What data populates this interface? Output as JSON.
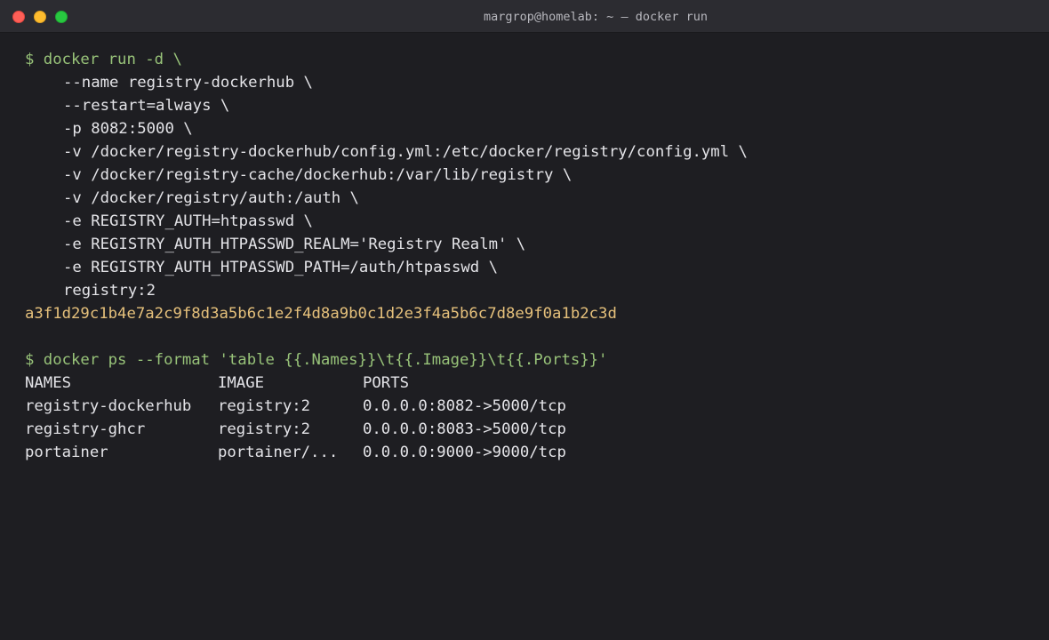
{
  "window": {
    "title": "margrop@homelab: ~ — docker run",
    "buttons": {
      "close": "close",
      "minimize": "minimize",
      "maximize": "maximize"
    }
  },
  "terminal": {
    "run_command": {
      "prompt_line": "$ docker run -d \\",
      "args": [
        "--name registry-dockerhub \\",
        "--restart=always \\",
        "-p 8082:5000 \\",
        "-v /docker/registry-dockerhub/config.yml:/etc/docker/registry/config.yml \\",
        "-v /docker/registry-cache/dockerhub:/var/lib/registry \\",
        "-v /docker/registry/auth:/auth \\",
        "-e REGISTRY_AUTH=htpasswd \\",
        "-e REGISTRY_AUTH_HTPASSWD_REALM='Registry Realm' \\",
        "-e REGISTRY_AUTH_HTPASSWD_PATH=/auth/htpasswd \\",
        "registry:2"
      ],
      "output_hash": "a3f1d29c1b4e7a2c9f8d3a5b6c1e2f4d8a9b0c1d2e3f4a5b6c7d8e9f0a1b2c3d"
    },
    "ps_command": {
      "prompt_line": "$ docker ps --format 'table {{.Names}}\\t{{.Image}}\\t{{.Ports}}'",
      "headers": [
        "NAMES",
        "IMAGE",
        "PORTS"
      ],
      "rows": [
        [
          "registry-dockerhub",
          "registry:2",
          "0.0.0.0:8082->5000/tcp"
        ],
        [
          "registry-ghcr",
          "registry:2",
          "0.0.0.0:8083->5000/tcp"
        ],
        [
          "portainer",
          "portainer/...",
          "0.0.0.0:9000->9000/tcp"
        ]
      ]
    }
  },
  "colors": {
    "background": "#1e1e22",
    "titlebar": "#2c2c31",
    "command": "#98c379",
    "hash": "#e5c07b",
    "text": "#e4e4e8"
  }
}
